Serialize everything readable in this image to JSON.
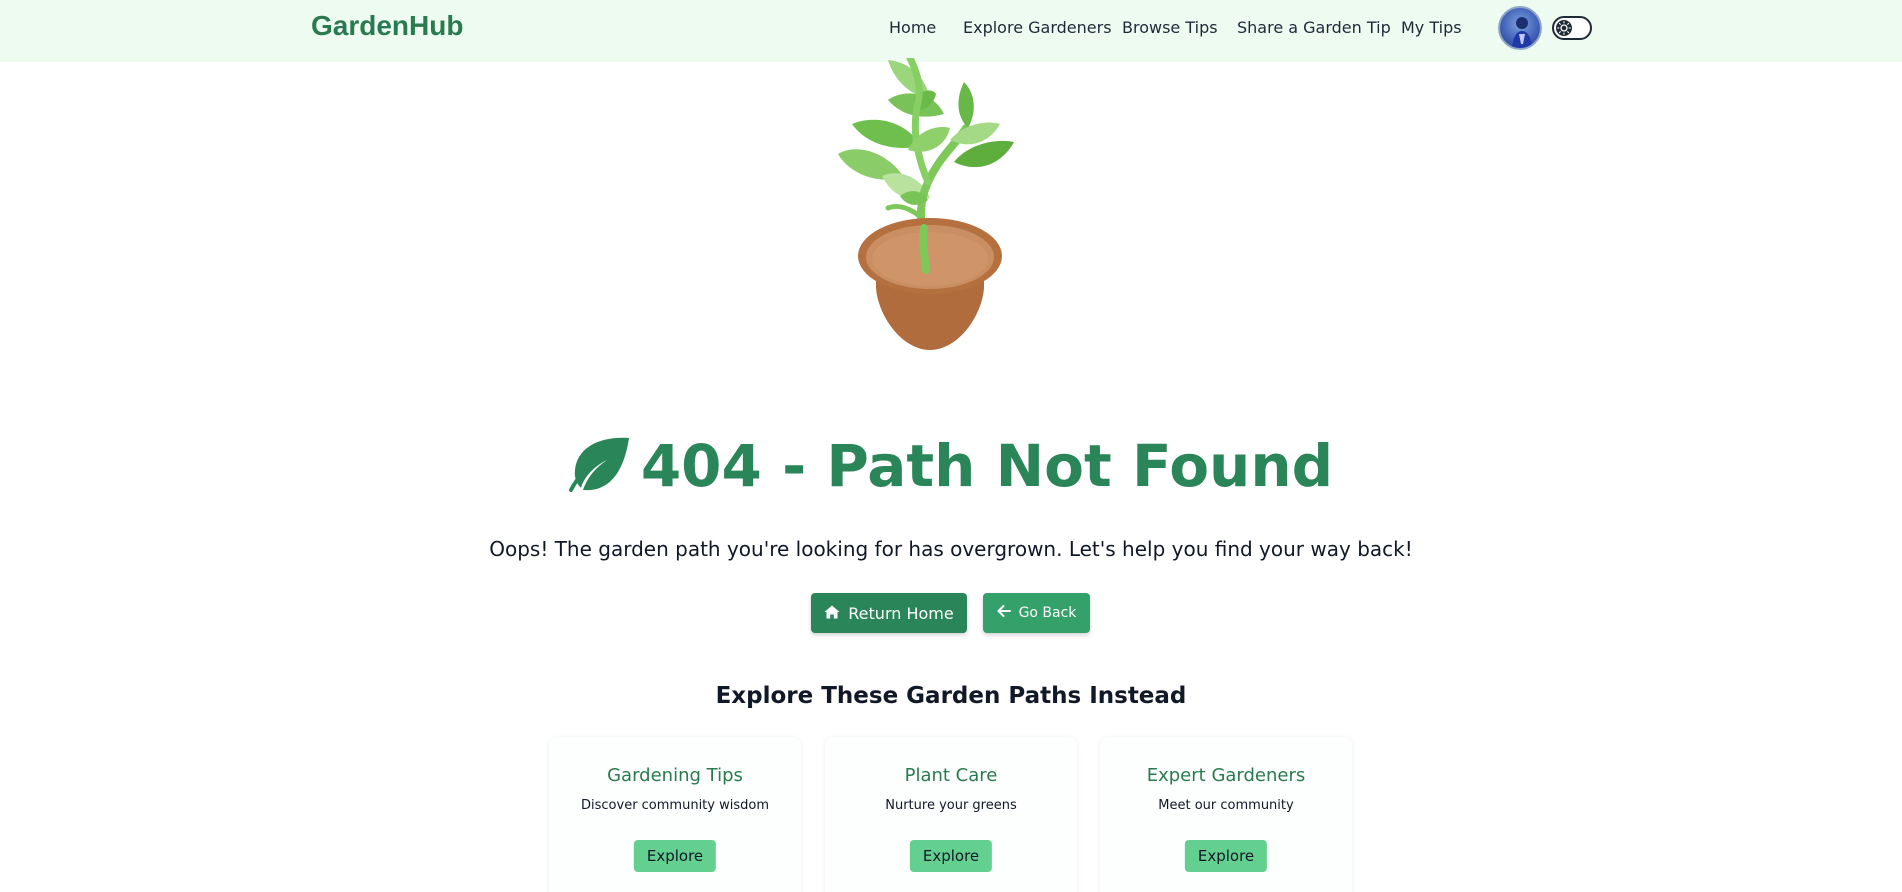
{
  "navbar": {
    "brand": "GardenHub",
    "links": [
      {
        "label": "Home"
      },
      {
        "label": "Explore Gardeners"
      },
      {
        "label": "Browse Tips"
      },
      {
        "label": "Share a Garden Tip"
      },
      {
        "label": "My Tips"
      }
    ]
  },
  "error": {
    "heading": "404 - Path Not Found",
    "message": "Oops! The garden path you're looking for has overgrown. Let's help you find your way back!",
    "return_home_label": "Return Home",
    "go_back_label": "Go Back"
  },
  "explore": {
    "title": "Explore These Garden Paths Instead",
    "cards": [
      {
        "title": "Gardening Tips",
        "description": "Discover community wisdom",
        "button": "Explore"
      },
      {
        "title": "Plant Care",
        "description": "Nurture your greens",
        "button": "Explore"
      },
      {
        "title": "Expert Gardeners",
        "description": "Meet our community",
        "button": "Explore"
      }
    ]
  },
  "icons": {
    "heading_icon": "leaf-icon",
    "home_button_icon": "home-icon",
    "back_button_icon": "arrow-left-icon",
    "theme_toggle_icon": "theme-toggle-icon"
  },
  "colors": {
    "brand_green": "#2a7a50",
    "primary_button": "#2a8558",
    "secondary_button": "#34a06a",
    "card_button": "#63d08f",
    "navbar_bg": "#edfbf1"
  }
}
